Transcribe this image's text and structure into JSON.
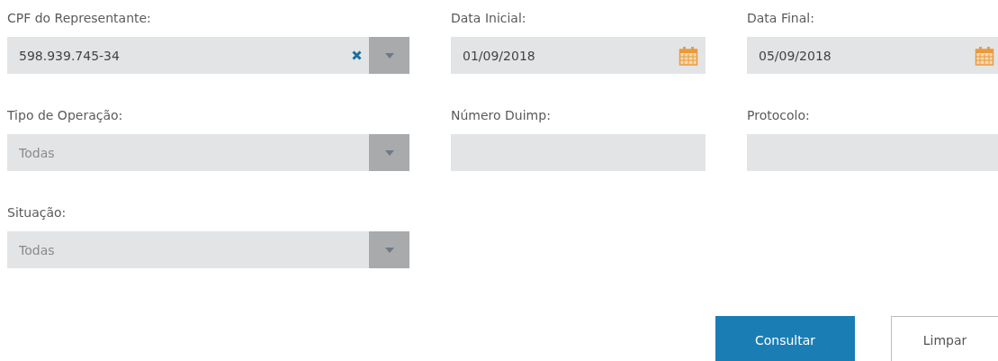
{
  "fields": [
    {
      "kind": "select",
      "label": "CPF do Representante:",
      "value": "598.939.745-34",
      "clearable": true
    },
    {
      "kind": "date",
      "label": "Data Inicial:",
      "value": "01/09/2018"
    },
    {
      "kind": "date",
      "label": "Data Final:",
      "value": "05/09/2018"
    },
    {
      "kind": "select",
      "label": "Tipo de Operação:",
      "placeholder": "Todas",
      "clearable": false
    },
    {
      "kind": "text",
      "label": "Número Duimp:"
    },
    {
      "kind": "text",
      "label": "Protocolo:"
    },
    {
      "kind": "select",
      "label": "Situação:",
      "placeholder": "Todas",
      "clearable": false
    }
  ],
  "buttons": [
    {
      "label": "Consultar",
      "kind": "primary"
    },
    {
      "label": "Limpar",
      "kind": "secondary"
    }
  ]
}
